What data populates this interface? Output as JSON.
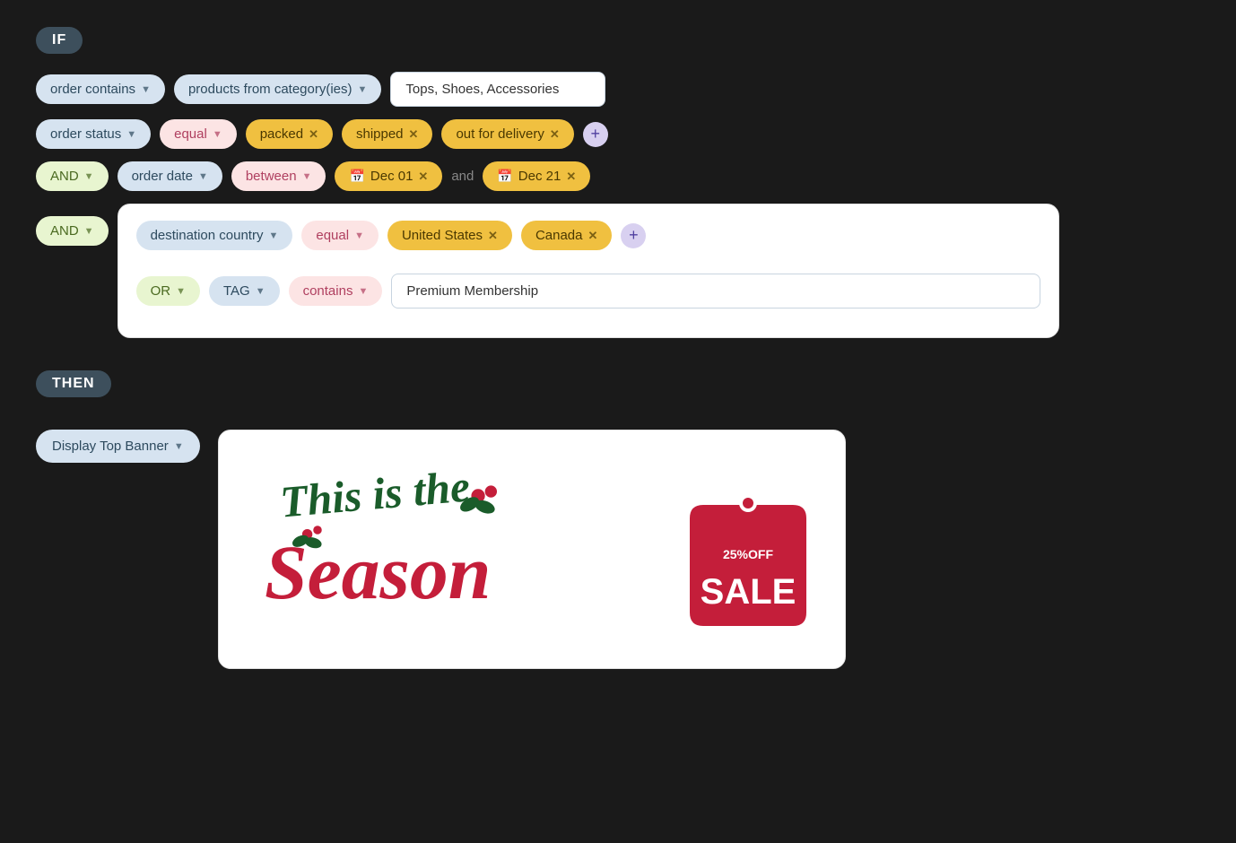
{
  "if_label": "IF",
  "then_label": "THEN",
  "row1": {
    "chip1": "order contains",
    "chip2": "products from category(ies)",
    "input_value": "Tops, Shoes, Accessories",
    "input_placeholder": "Tops, Shoes, Accessories"
  },
  "row2": {
    "chip1": "order status",
    "chip2": "equal",
    "tag1": "packed",
    "tag2": "shipped",
    "tag3": "out for delivery"
  },
  "row3": {
    "chip_and": "AND",
    "chip_date": "order date",
    "chip_between": "between",
    "date1": "Dec 01",
    "date2": "Dec 21"
  },
  "row4": {
    "chip_and": "AND",
    "nested": {
      "chip_dest": "destination country",
      "chip_equal": "equal",
      "tag1": "United States",
      "tag2": "Canada",
      "chip_or": "OR",
      "chip_tag": "TAG",
      "chip_contains": "contains",
      "input_value": "Premium Membership",
      "input_placeholder": "Premium Membership"
    }
  },
  "then": {
    "chip_label": "Display Top Banner",
    "banner_alt": "This is the Season - 25% OFF SALE"
  }
}
